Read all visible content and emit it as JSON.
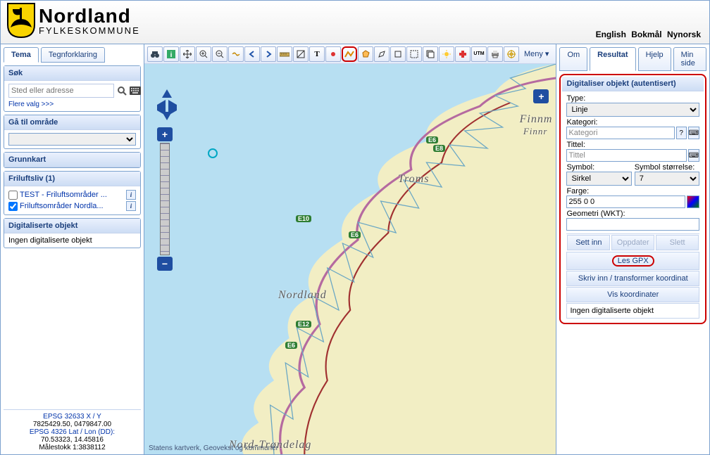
{
  "header": {
    "brand1": "Nordland",
    "brand2": "FYLKESKOMMUNE",
    "lang_en": "English",
    "lang_bm": "Bokmål",
    "lang_nn": "Nynorsk"
  },
  "left": {
    "tab_tema": "Tema",
    "tab_tegn": "Tegnforklaring",
    "sok_h": "Søk",
    "sok_ph": "Sted eller adresse",
    "sok_more": "Flere valg >>>",
    "goto_h": "Gå til område",
    "base_h": "Grunnkart",
    "fri_h": "Friluftsliv (1)",
    "layer1": "TEST - Friluftsområder ...",
    "layer2": "Friluftsområder Nordla...",
    "dig_h": "Digitaliserte objekt",
    "dig_none": "Ingen digitaliserte objekt",
    "crs1": "EPSG 32633 X / Y",
    "crs1v": "7825429.50, 0479847.00",
    "crs2": "EPSG 4326 Lat / Lon (DD):",
    "crs2v": "70.53323, 14.45816",
    "scale": "Målestokk 1:3838112"
  },
  "toolbar": {
    "menu": "Meny"
  },
  "map": {
    "r_finnm": "Finnm",
    "r_finnr": "Finnr",
    "r_troms": "Troms",
    "r_nordland": "Nordland",
    "r_nt": "Nord-Trøndelag",
    "e6a": "E6",
    "e6b": "E6",
    "e6c": "E6",
    "e8": "E8",
    "e10": "E10",
    "e12": "E12",
    "credit": "Statens kartverk, Geovekst og kommuner"
  },
  "right": {
    "tab_om": "Om",
    "tab_res": "Resultat",
    "tab_hjelp": "Hjelp",
    "tab_min": "Min side",
    "panel_h": "Digitaliser objekt (autentisert)",
    "l_type": "Type:",
    "v_type": "Linje",
    "l_kat": "Kategori:",
    "v_kat": "Kategori",
    "l_tit": "Tittel:",
    "v_tit": "Tittel",
    "l_sym": "Symbol:",
    "l_symsz": "Symbol størrelse:",
    "v_sym": "Sirkel",
    "v_symsz": "7",
    "l_farge": "Farge:",
    "v_farge": "255 0 0",
    "l_geom": "Geometri (WKT):",
    "b_sett": "Sett inn",
    "b_opp": "Oppdater",
    "b_slett": "Slett",
    "b_gpx": "Les GPX",
    "b_skriv": "Skriv inn / transformer koordinat",
    "b_vis": "Vis koordinater",
    "none": "Ingen digitaliserte objekt"
  }
}
